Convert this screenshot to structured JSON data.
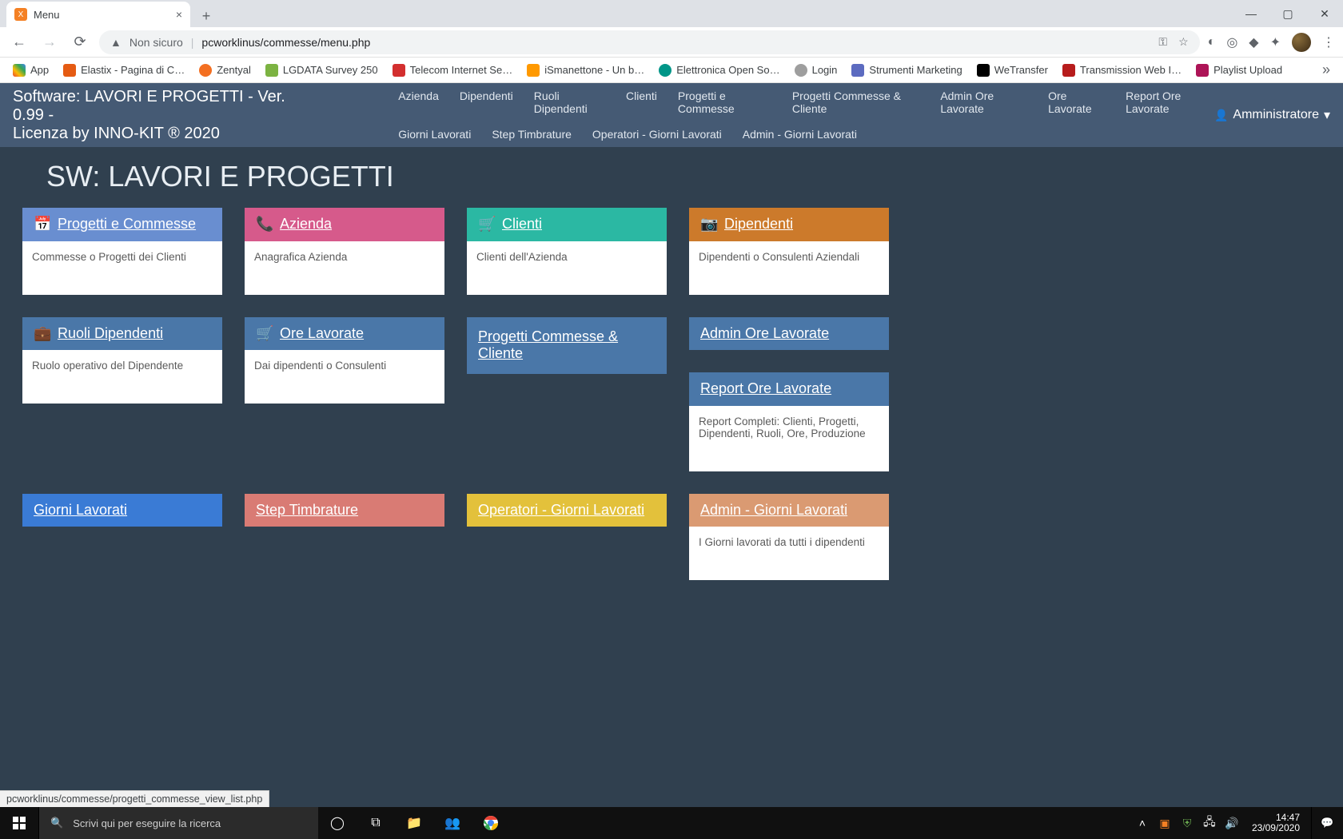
{
  "browser": {
    "tab_title": "Menu",
    "new_tab_tooltip": "+",
    "url_security": "Non sicuro",
    "url": "pcworklinus/commesse/menu.php",
    "hover_url": "pcworklinus/commesse/progetti_commesse_view_list.php"
  },
  "bookmarks": [
    {
      "label": "App"
    },
    {
      "label": "Elastix - Pagina di C…"
    },
    {
      "label": "Zentyal"
    },
    {
      "label": "LGDATA Survey 250"
    },
    {
      "label": "Telecom Internet Se…"
    },
    {
      "label": "iSmanettone - Un b…"
    },
    {
      "label": "Elettronica Open So…"
    },
    {
      "label": "Login"
    },
    {
      "label": "Strumenti Marketing"
    },
    {
      "label": "WeTransfer"
    },
    {
      "label": "Transmission Web I…"
    },
    {
      "label": "Playlist Upload"
    }
  ],
  "app": {
    "title_line1": "Software: LAVORI E PROGETTI - Ver. 0.99 -",
    "title_line2": "Licenza by INNO-KIT ® 2020",
    "user_label": "Amministratore",
    "nav_row1": [
      "Azienda",
      "Dipendenti",
      "Ruoli Dipendenti",
      "Clienti",
      "Progetti e Commesse",
      "Progetti Commesse & Cliente",
      "Admin Ore Lavorate",
      "Ore Lavorate",
      "Report Ore Lavorate"
    ],
    "nav_row2": [
      "Giorni Lavorati",
      "Step Timbrature",
      "Operatori - Giorni Lavorati",
      "Admin - Giorni Lavorati"
    ]
  },
  "page_heading": "SW: LAVORI E PROGETTI",
  "cards": {
    "r1c1": {
      "title": "Progetti e Commesse",
      "body": "Commesse o Progetti dei Clienti"
    },
    "r1c2": {
      "title": "Azienda",
      "body": "Anagrafica Azienda"
    },
    "r1c3": {
      "title": "Clienti",
      "body": "Clienti dell'Azienda"
    },
    "r1c4": {
      "title": "Dipendenti",
      "body": "Dipendenti o Consulenti Aziendali"
    },
    "r2c1": {
      "title": "Ruoli Dipendenti",
      "body": "Ruolo operativo del Dipendente"
    },
    "r2c2": {
      "title": "Ore Lavorate",
      "body": "Dai dipendenti o Consulenti"
    },
    "r2c3": {
      "title": "Progetti Commesse & Cliente"
    },
    "r2c4a": {
      "title": "Admin Ore Lavorate"
    },
    "r2c4b": {
      "title": "Report Ore Lavorate",
      "body": "Report Completi: Clienti, Progetti, Dipendenti, Ruoli, Ore, Produzione"
    },
    "r3c1": {
      "title": "Giorni Lavorati"
    },
    "r3c2": {
      "title": "Step Timbrature"
    },
    "r3c3": {
      "title": "Operatori - Giorni Lavorati"
    },
    "r3c4": {
      "title": "Admin - Giorni Lavorati",
      "body": "I Giorni lavorati da tutti i dipendenti"
    }
  },
  "taskbar": {
    "search_placeholder": "Scrivi qui per eseguire la ricerca",
    "time": "14:47",
    "date": "23/09/2020"
  }
}
